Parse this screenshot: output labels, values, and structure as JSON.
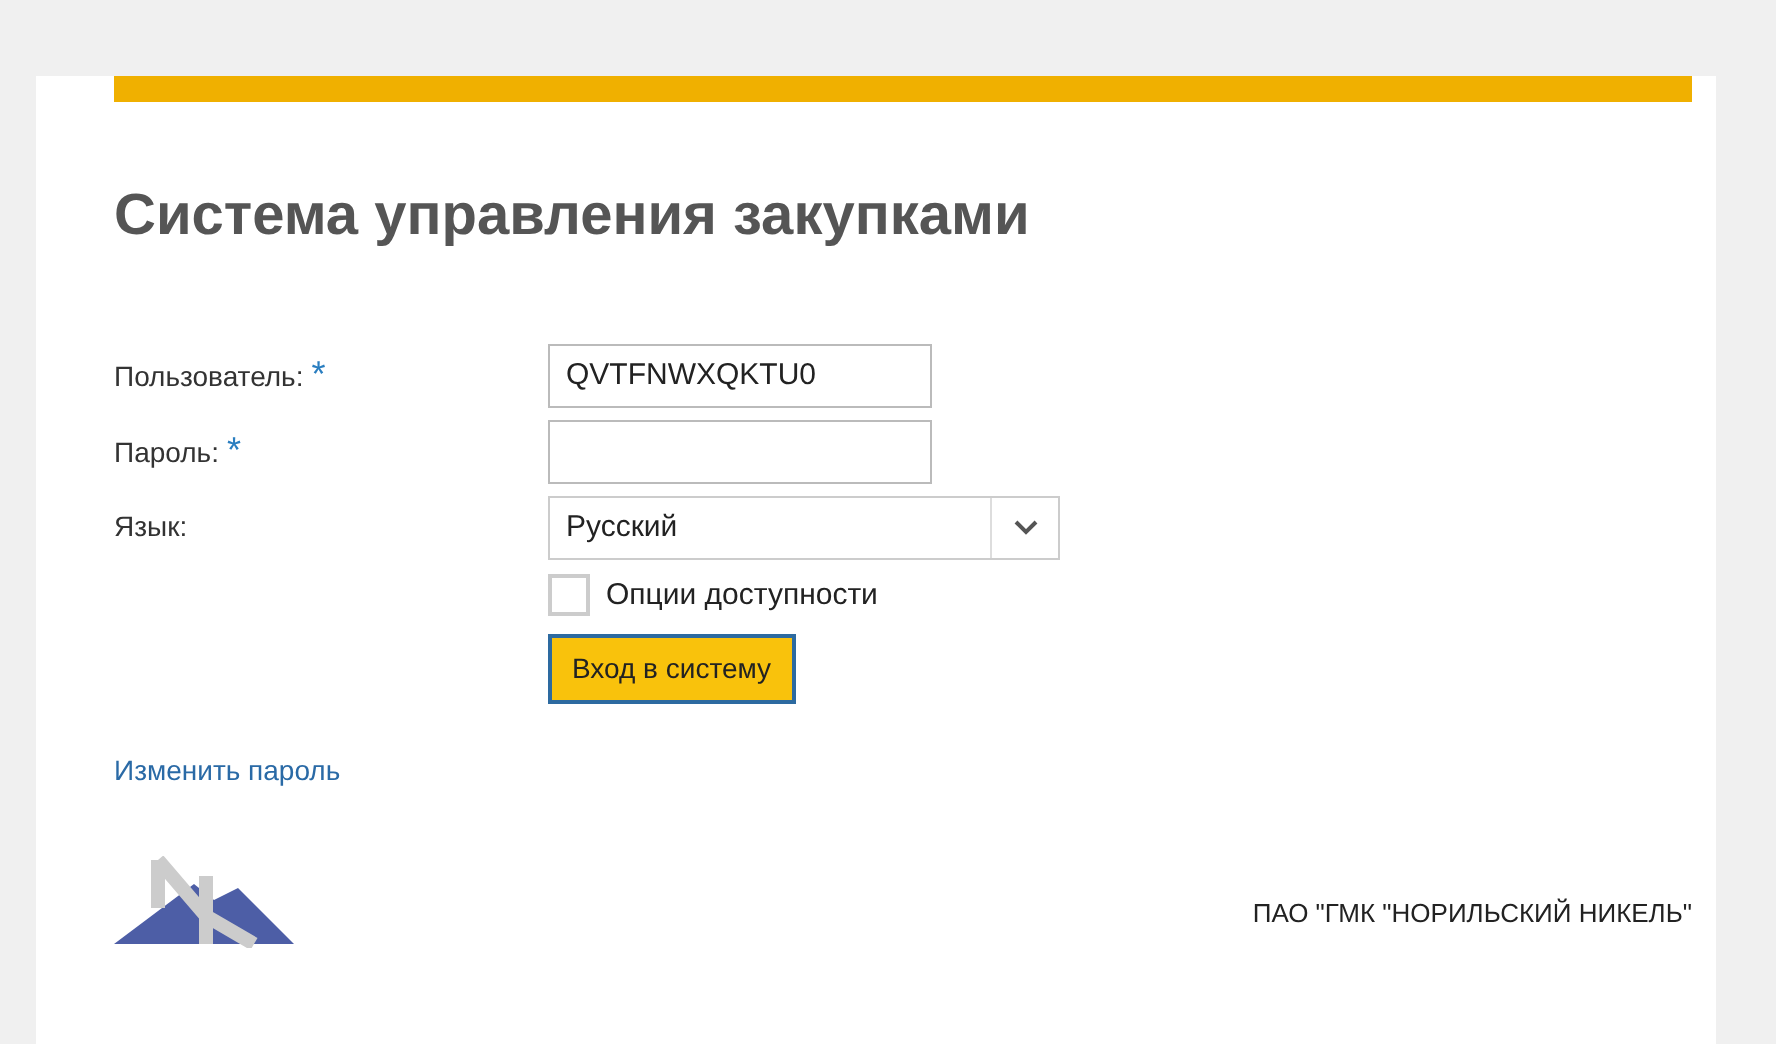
{
  "title": "Система управления закупками",
  "fields": [
    {
      "label": "Пользователь:",
      "required_mark": "*",
      "value": "QVTFNWXQKTU0"
    },
    {
      "label": "Пароль:",
      "required_mark": "*"
    }
  ],
  "language": {
    "label": "Язык:",
    "value": "Русский"
  },
  "accessibility": {
    "label": "Опции доступности",
    "checked": false
  },
  "login_button": "Вход в систему",
  "change_password_link": "Изменить пароль",
  "company": "ПАО \"ГМК \"НОРИЛЬСКИЙ НИКЕЛЬ\""
}
